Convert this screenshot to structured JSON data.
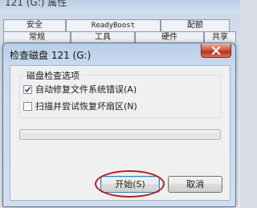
{
  "background_window": {
    "title": "121 (G:) 属性",
    "tabs_row1": [
      "安全",
      "ReadyBoost",
      "配额"
    ],
    "tabs_row2": [
      "常规",
      "工具",
      "硬件",
      "共享"
    ]
  },
  "dialog": {
    "title": "检查磁盘 121 (G:)",
    "close_label": "×",
    "group_title": "磁盘检查选项",
    "options": [
      {
        "label": "自动修复文件系统错误(A)",
        "checked": true
      },
      {
        "label": "扫描并尝试恢复坏扇区(N)",
        "checked": false
      }
    ],
    "progress": 0,
    "start_button": "开始(S)",
    "cancel_button": "取消"
  },
  "colors": {
    "annotation": "#b51e23",
    "close_button": "#c8452d"
  }
}
